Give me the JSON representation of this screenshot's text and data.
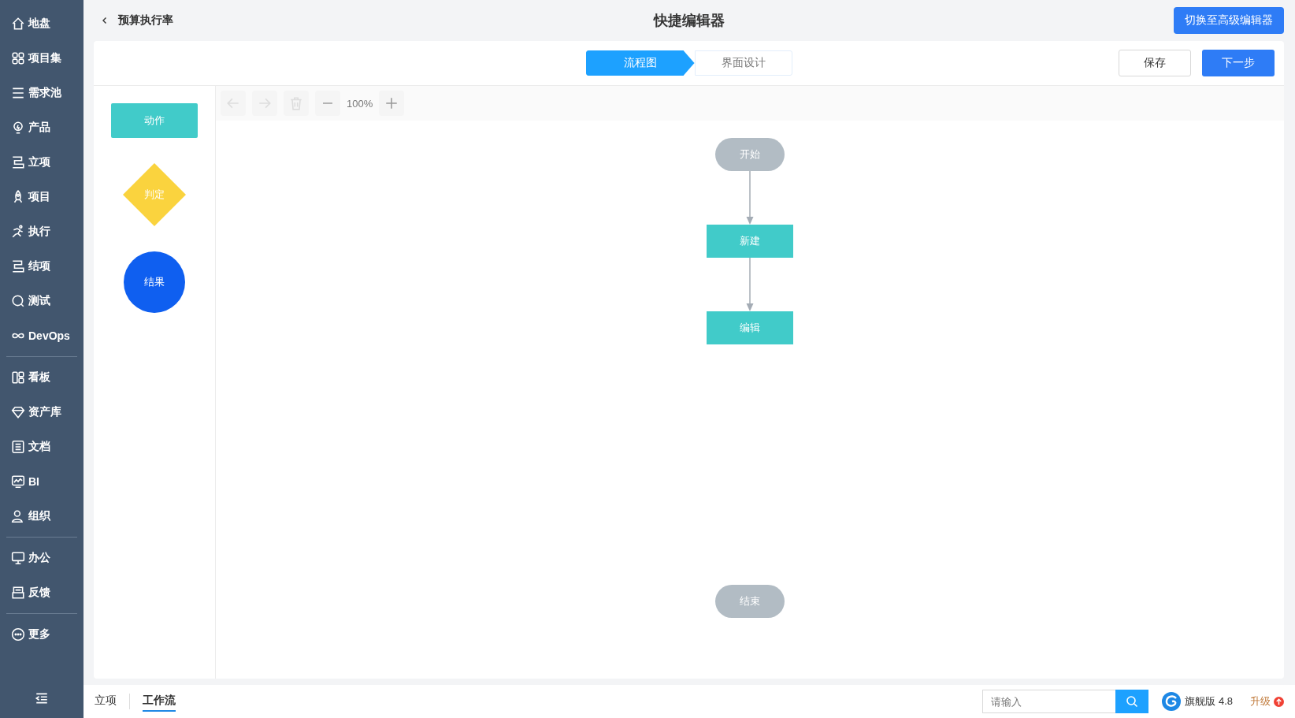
{
  "sidebar": {
    "groups": [
      [
        {
          "label": "地盘"
        },
        {
          "label": "项目集"
        },
        {
          "label": "需求池"
        },
        {
          "label": "产品"
        },
        {
          "label": "立项"
        },
        {
          "label": "项目"
        },
        {
          "label": "执行"
        },
        {
          "label": "结项"
        },
        {
          "label": "测试"
        },
        {
          "label": "DevOps"
        }
      ],
      [
        {
          "label": "看板"
        },
        {
          "label": "资产库"
        },
        {
          "label": "文档"
        },
        {
          "label": "BI"
        },
        {
          "label": "组织"
        }
      ],
      [
        {
          "label": "办公"
        },
        {
          "label": "反馈"
        }
      ],
      [
        {
          "label": "更多"
        }
      ]
    ]
  },
  "header": {
    "back_label": "预算执行率",
    "title": "快捷编辑器",
    "switch_button": "切换至高级编辑器"
  },
  "steps": [
    {
      "label": "流程图",
      "selected": true
    },
    {
      "label": "界面设计",
      "selected": false
    }
  ],
  "actions": {
    "save": "保存",
    "next": "下一步"
  },
  "palette": [
    {
      "kind": "action",
      "label": "动作"
    },
    {
      "kind": "decision",
      "label": "判定"
    },
    {
      "kind": "result",
      "label": "结果"
    }
  ],
  "toolbar": {
    "zoom": "100%",
    "undo_disabled": true,
    "redo_disabled": true,
    "delete_disabled": true
  },
  "flow": {
    "nodes": [
      {
        "kind": "terminal",
        "label": "开始",
        "arrow_to_next": true
      },
      {
        "kind": "process",
        "label": "新建",
        "arrow_to_next": true
      },
      {
        "kind": "process",
        "label": "编辑",
        "arrow_to_next": false
      }
    ],
    "end_node": {
      "kind": "terminal",
      "label": "结束"
    }
  },
  "footer": {
    "tabs": [
      {
        "label": "立项",
        "selected": false
      },
      {
        "label": "工作流",
        "selected": true
      }
    ],
    "search": {
      "placeholder": "请输入"
    },
    "edition": "旗舰版 4.8",
    "upgrade": "升级"
  }
}
